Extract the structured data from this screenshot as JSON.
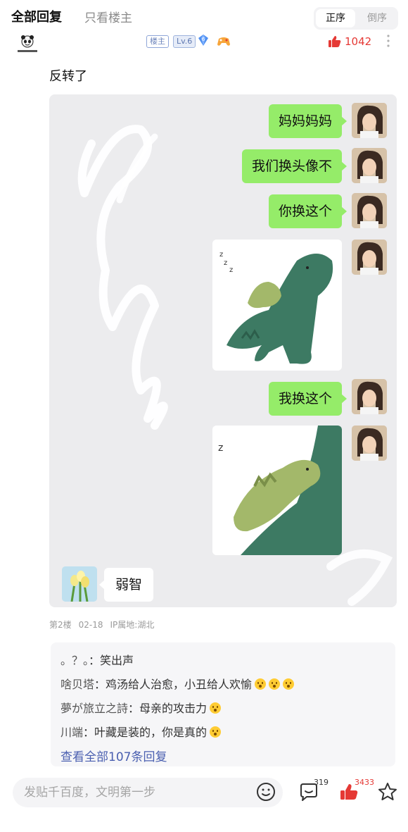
{
  "tabs": {
    "all_replies": "全部回复",
    "only_op": "只看楼主"
  },
  "order": {
    "asc": "正序",
    "desc": "倒序"
  },
  "author": {
    "avatar_icon": "panda-meme-avatar",
    "op_badge": "楼主",
    "level": "Lv.6",
    "gem_level": "6",
    "like_count": "1042"
  },
  "post": {
    "text": "反转了"
  },
  "chat": {
    "messages": [
      "妈妈妈妈",
      "我们换头像不",
      "你换这个"
    ],
    "message_after_sticker": "我换这个",
    "reply": "弱智"
  },
  "meta": {
    "floor": "第2楼",
    "date": "02-18",
    "ip": "IP属地:湖北"
  },
  "replies": [
    {
      "user": "。？。",
      "text": "笑出声",
      "emojis": 0
    },
    {
      "user": "啥贝塔",
      "text": "鸡汤给人治愈，小丑给人欢愉",
      "emojis": 3
    },
    {
      "user": "夢が旅立之詩",
      "text": "母亲的攻击力",
      "emojis": 1
    },
    {
      "user": "川端",
      "text": "叶藏是装的，你是真的",
      "emojis": 1
    }
  ],
  "view_all": "查看全部107条回复",
  "bottom": {
    "placeholder": "发贴千百度，文明第一步",
    "comment_count": "319",
    "like_count": "3433"
  },
  "colors": {
    "accent_red": "#e53935",
    "wechat_green": "#95ec69",
    "link_blue": "#4a5fb0"
  }
}
